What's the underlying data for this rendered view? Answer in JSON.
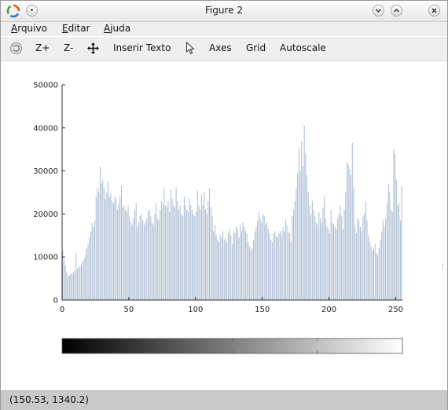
{
  "window": {
    "title": "Figure 2"
  },
  "menubar": {
    "items": [
      {
        "label": "Arquivo",
        "mnemonic": "A",
        "rest": "rquivo"
      },
      {
        "label": "Editar",
        "mnemonic": "E",
        "rest": "ditar"
      },
      {
        "label": "Ajuda",
        "mnemonic": "A",
        "rest": "juda"
      }
    ]
  },
  "toolbar": {
    "zoom_in": "Z+",
    "zoom_out": "Z-",
    "insert_text": "Inserir Texto",
    "axes": "Axes",
    "grid": "Grid",
    "autoscale": "Autoscale"
  },
  "status": {
    "coordinates": "(150.53, 1340.2)"
  },
  "colors": {
    "bar": "#aabcd2",
    "axis": "#333333"
  },
  "chart_data": {
    "type": "bar",
    "title": "",
    "xlabel": "",
    "ylabel": "",
    "xlim": [
      0,
      255
    ],
    "ylim": [
      0,
      50000
    ],
    "xticks": [
      "0",
      "50",
      "100",
      "150",
      "200",
      "250"
    ],
    "yticks": [
      "0",
      "10000",
      "20000",
      "30000",
      "40000",
      "50000"
    ],
    "grid": false,
    "values": [
      11500,
      9500,
      8000,
      6500,
      5500,
      5800,
      6000,
      6200,
      6500,
      6800,
      11000,
      7200,
      7500,
      8000,
      8500,
      9000,
      9500,
      10500,
      12000,
      13000,
      14500,
      16000,
      18000,
      17000,
      18500,
      24000,
      26000,
      25000,
      31000,
      27000,
      28000,
      26000,
      23500,
      25000,
      27500,
      24000,
      25000,
      23000,
      22500,
      24000,
      23500,
      21000,
      22500,
      24000,
      26500,
      21500,
      22000,
      21000,
      20500,
      22000,
      19500,
      18000,
      17500,
      19000,
      21000,
      22500,
      17000,
      18000,
      19500,
      20000,
      18500,
      17500,
      18000,
      19000,
      20500,
      21000,
      19500,
      18000,
      17500,
      20000,
      22500,
      19000,
      18500,
      21000,
      23000,
      22000,
      26000,
      22000,
      21500,
      23000,
      20500,
      25500,
      23500,
      22000,
      21500,
      26000,
      23000,
      21000,
      22000,
      20000,
      19500,
      24000,
      22000,
      21000,
      20500,
      23500,
      22000,
      21000,
      20000,
      19500,
      20500,
      25500,
      22000,
      21000,
      24500,
      22000,
      25000,
      21000,
      20000,
      23000,
      26000,
      21500,
      19500,
      16000,
      17500,
      15000,
      14000,
      13500,
      15000,
      14500,
      16000,
      14000,
      14500,
      13500,
      15500,
      16500,
      15000,
      13000,
      16000,
      15500,
      17000,
      16500,
      14500,
      17500,
      16000,
      18000,
      17000,
      16000,
      15500,
      13500,
      12500,
      11500,
      12000,
      14000,
      16000,
      17000,
      18500,
      20500,
      19000,
      18000,
      20000,
      19500,
      17500,
      18000,
      16500,
      15500,
      14000,
      13500,
      15500,
      16000,
      15000,
      14500,
      15500,
      16000,
      15000,
      17000,
      16000,
      18500,
      17500,
      16000,
      15500,
      13500,
      19500,
      21000,
      23000,
      26000,
      29500,
      35500,
      30000,
      37000,
      31000,
      40500,
      34000,
      29000,
      25000,
      22000,
      20000,
      23000,
      21000,
      19500,
      18000,
      17500,
      20500,
      19000,
      18000,
      21500,
      24000,
      19000,
      17000,
      16500,
      15500,
      21000,
      18000,
      17500,
      17000,
      16500,
      19000,
      20000,
      22000,
      19500,
      16500,
      21000,
      25000,
      32000,
      31500,
      30500,
      29000,
      36500,
      26000,
      17500,
      15500,
      19000,
      18500,
      17000,
      16000,
      19500,
      20000,
      23000,
      18500,
      15000,
      13500,
      12500,
      11500,
      12000,
      13000,
      11000,
      10500,
      12000,
      14000,
      16000,
      18500,
      17000,
      19000,
      22500,
      27000,
      25000,
      21000,
      20500,
      35000,
      34000,
      28000,
      22000,
      22500,
      18500,
      26500
    ],
    "colorbar": {
      "type": "grayscale",
      "range": [
        0,
        255
      ]
    }
  }
}
